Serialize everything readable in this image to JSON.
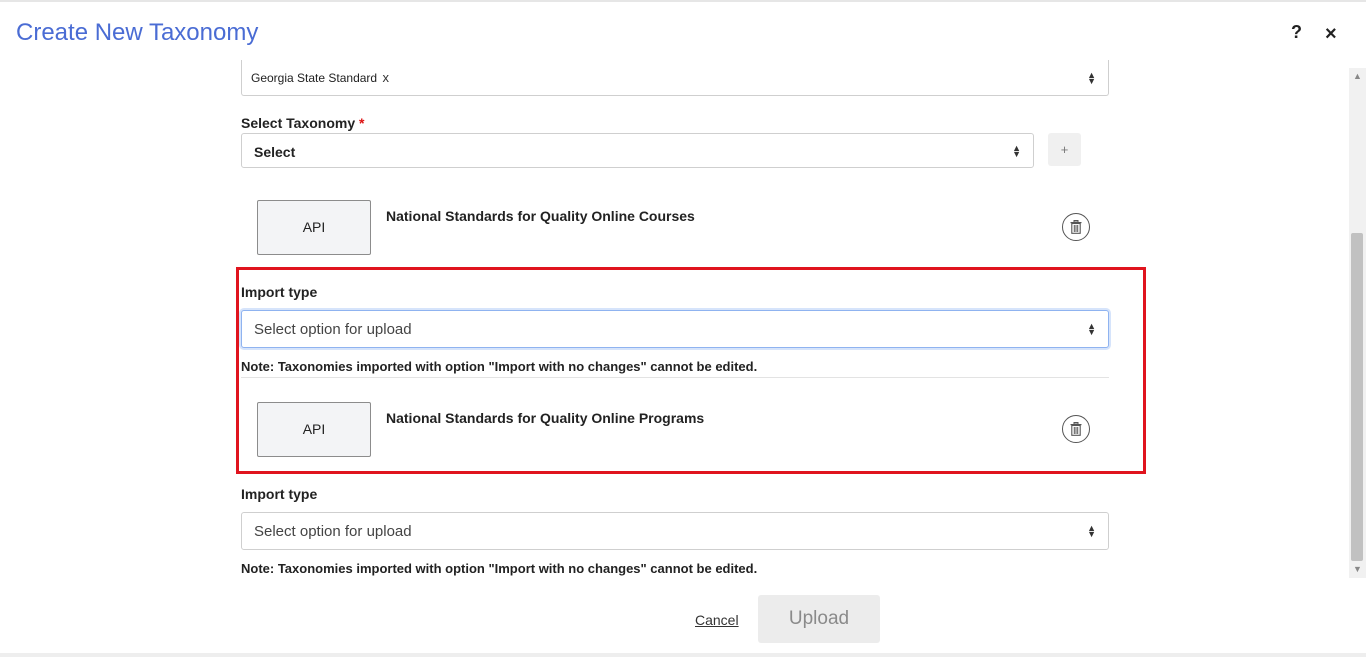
{
  "header": {
    "title": "Create New Taxonomy",
    "help_label": "?",
    "close_label": "×"
  },
  "standard_select": {
    "tag": "Georgia State Standard",
    "tag_remove": "x"
  },
  "taxonomy": {
    "label": "Select Taxonomy",
    "required_mark": "*",
    "value": "Select",
    "add_label": "+"
  },
  "items": [
    {
      "badge": "API",
      "title": "National Standards for Quality Online Courses",
      "import_label": "Import type",
      "import_placeholder": "Select option for upload",
      "note": "Note: Taxonomies imported with option \"Import with no changes\" cannot be edited."
    },
    {
      "badge": "API",
      "title": "National Standards for Quality Online Programs",
      "import_label": "Import type",
      "import_placeholder": "Select option for upload",
      "note": "Note: Taxonomies imported with option \"Import with no changes\" cannot be edited."
    }
  ],
  "footer": {
    "cancel_label": "Cancel",
    "upload_label": "Upload"
  },
  "colors": {
    "title": "#4a6cd4",
    "highlight": "#e0141e",
    "required": "#dd1111"
  }
}
